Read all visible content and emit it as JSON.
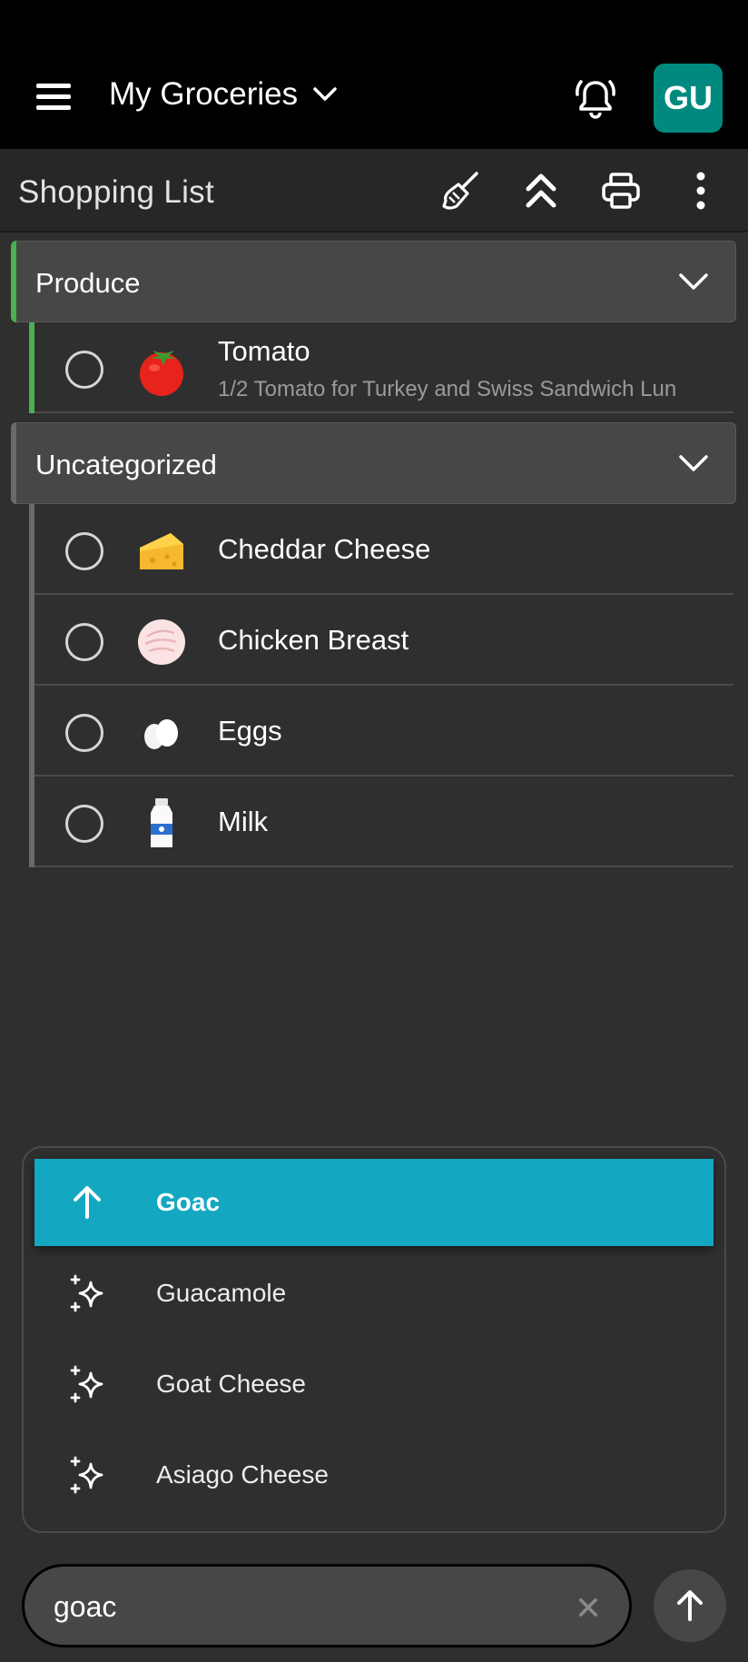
{
  "app_bar": {
    "list_name": "My Groceries",
    "avatar_initials": "GU",
    "avatar_color": "#008a7f"
  },
  "toolbar": {
    "title": "Shopping List"
  },
  "categories": [
    {
      "label": "Produce",
      "accent_color": "#4caf50",
      "items": [
        {
          "name": "Tomato",
          "note": "1/2 Tomato for Turkey and Swiss Sandwich Lun",
          "icon": "tomato-icon"
        }
      ]
    },
    {
      "label": "Uncategorized",
      "accent_color": "#6a6a6a",
      "items": [
        {
          "name": "Cheddar Cheese",
          "icon": "cheese-icon"
        },
        {
          "name": "Chicken Breast",
          "icon": "chicken-breast-icon"
        },
        {
          "name": "Eggs",
          "icon": "eggs-icon"
        },
        {
          "name": "Milk",
          "icon": "milk-icon"
        }
      ]
    }
  ],
  "suggestions": [
    {
      "label": "Goac",
      "icon": "arrow-up-icon",
      "highlighted": true
    },
    {
      "label": "Guacamole",
      "icon": "sparkle-icon"
    },
    {
      "label": "Goat Cheese",
      "icon": "sparkle-icon"
    },
    {
      "label": "Asiago Cheese",
      "icon": "sparkle-icon"
    }
  ],
  "input": {
    "value": "goac"
  },
  "highlight_color": "#14a7c2"
}
